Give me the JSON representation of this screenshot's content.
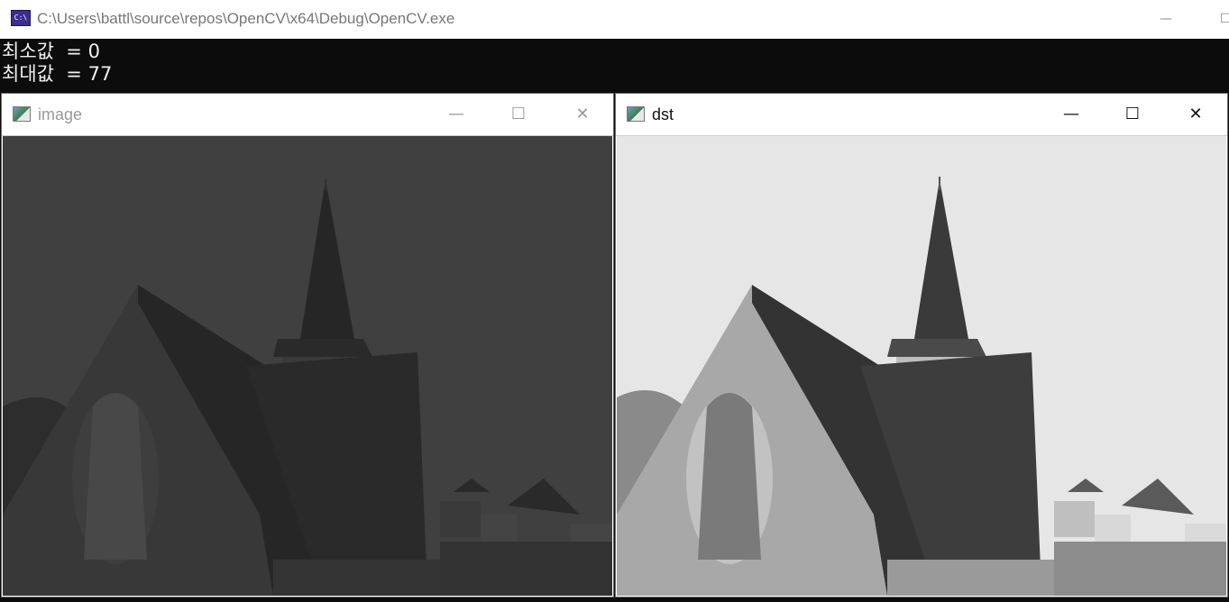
{
  "console": {
    "title": "C:\\Users\\battl\\source\\repos\\OpenCV\\x64\\Debug\\OpenCV.exe",
    "app_icon_text": "C:\\",
    "lines": [
      "최소값  = 0",
      "최대값  = 77"
    ]
  },
  "windows": [
    {
      "title": "image",
      "state": "inactive",
      "brightness": "dark"
    },
    {
      "title": "dst",
      "state": "active",
      "brightness": "normalized"
    }
  ],
  "controls": {
    "minimize": "—",
    "maximize": "☐",
    "close": "✕"
  }
}
